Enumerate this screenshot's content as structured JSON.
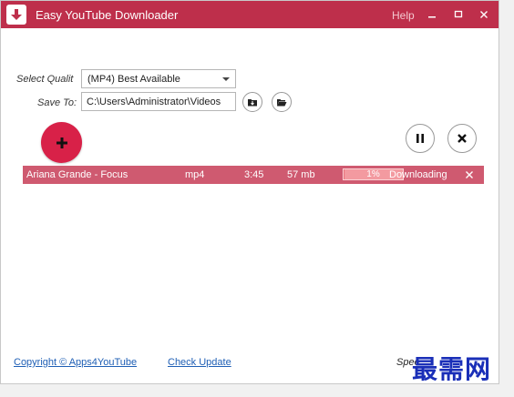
{
  "window": {
    "title": "Easy YouTube Downloader",
    "help": "Help"
  },
  "form": {
    "quality_label": "Select Qualit",
    "quality_value": "(MP4) Best Available",
    "save_label": "Save To:",
    "save_path": "C:\\Users\\Administrator\\Videos"
  },
  "download": {
    "title": "Ariana Grande - Focus",
    "format": "mp4",
    "duration": "3:45",
    "size": "57 mb",
    "progress_label": "1%",
    "progress_fraction": 0.01,
    "status": "Downloading"
  },
  "footer": {
    "copyright": "Copyright © Apps4YouTube",
    "check_update": "Check Update",
    "speed_label": "Spee"
  },
  "watermark": "最需网",
  "colors": {
    "accent": "#be2f4b",
    "row": "#cf5a70",
    "add_button": "#d82148",
    "progress": "#f39aa0"
  }
}
